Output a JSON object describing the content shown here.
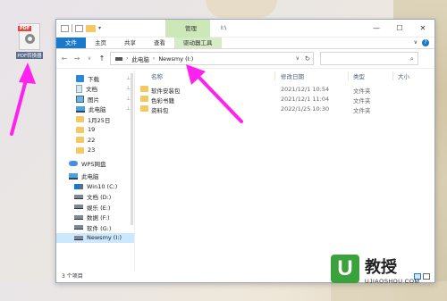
{
  "desktop": {
    "icon_badge": "PDF",
    "icon_label": "PDF转换器"
  },
  "window": {
    "ribbon_context_label": "管理",
    "title": "I:\\",
    "controls": {
      "minimize": "—",
      "maximize": "☐",
      "close": "✕"
    },
    "ribbon_tabs": [
      {
        "label": "文件"
      },
      {
        "label": "主页"
      },
      {
        "label": "共享"
      },
      {
        "label": "查看"
      },
      {
        "label": "驱动器工具"
      }
    ],
    "ribbon_right": {
      "collapse": "∨",
      "help": "?"
    },
    "nav": {
      "back": "←",
      "forward": "→",
      "recent": "∨",
      "up": "↑"
    },
    "address": {
      "root_sep": "›",
      "crumbs": [
        "此电脑",
        "Newsmy (I:)"
      ],
      "dropdown": "∨",
      "refresh": "↻"
    },
    "search": {
      "icon": "⌕"
    },
    "sidebar": {
      "items": [
        {
          "label": "下载",
          "icon": "download-icon",
          "pinned": true
        },
        {
          "label": "文档",
          "icon": "document-icon",
          "pinned": true
        },
        {
          "label": "图片",
          "icon": "picture-icon",
          "pinned": true
        },
        {
          "label": "此电脑",
          "icon": "computer-icon",
          "pinned": true
        },
        {
          "label": "1月25日",
          "icon": "folder-icon",
          "pinned": false
        },
        {
          "label": "19",
          "icon": "folder-icon",
          "pinned": false
        },
        {
          "label": "22",
          "icon": "folder-icon",
          "pinned": false
        },
        {
          "label": "23",
          "icon": "folder-icon",
          "pinned": false
        },
        {
          "label": "WPS网盘",
          "icon": "cloud-icon",
          "pinned": false
        },
        {
          "label": "此电脑",
          "icon": "computer-icon",
          "pinned": false
        },
        {
          "label": "Win10 (C:)",
          "icon": "windows-drive-icon",
          "pinned": false
        },
        {
          "label": "文档 (D:)",
          "icon": "drive-icon",
          "pinned": false
        },
        {
          "label": "娱乐 (E:)",
          "icon": "drive-icon",
          "pinned": false
        },
        {
          "label": "数据 (F:)",
          "icon": "drive-icon",
          "pinned": false
        },
        {
          "label": "软件 (G:)",
          "icon": "drive-icon",
          "pinned": false
        },
        {
          "label": "Newsmy (I:)",
          "icon": "drive-icon",
          "pinned": false,
          "selected": true
        }
      ],
      "pin_glyph": "⊥"
    },
    "columns": {
      "name": "名称",
      "date": "修改日期",
      "type": "类型",
      "size": "大小"
    },
    "files": [
      {
        "name": "软件安装包",
        "date": "2021/12/1 10:54",
        "type": "文件夹"
      },
      {
        "name": "色彩书籍",
        "date": "2021/12/1 11:04",
        "type": "文件夹"
      },
      {
        "name": "资料包",
        "date": "2022/1/25 10:30",
        "type": "文件夹"
      }
    ],
    "status": "3 个项目"
  },
  "watermark": {
    "logo_letter": "U",
    "brand": "教授",
    "domain": "UJIAOSHOU.COM"
  },
  "colors": {
    "accent": "#1979ca",
    "arrow": "#ff22ee",
    "folder": "#f4c862",
    "selection": "#cce8ff"
  }
}
